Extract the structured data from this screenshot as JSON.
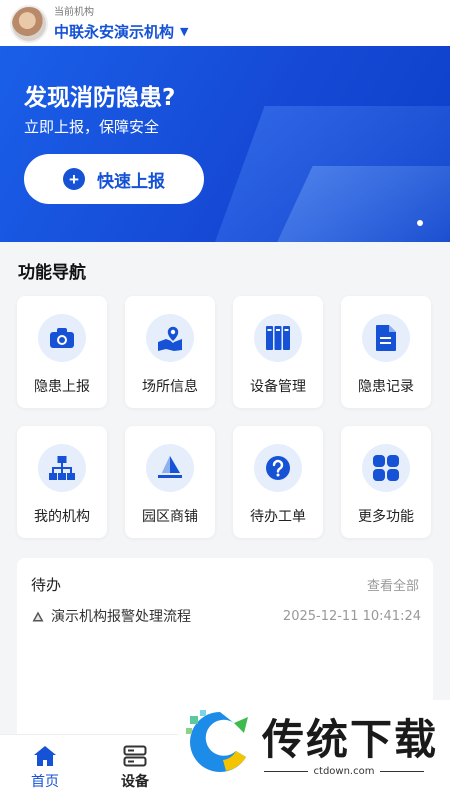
{
  "header": {
    "caption": "当前机构",
    "org_name": "中联永安演示机构",
    "caret": "▼"
  },
  "banner": {
    "title": "发现消防隐患?",
    "subtitle": "立即上报，保障安全",
    "quick_button_label": "快速上报",
    "plus": "+"
  },
  "nav_section": {
    "title": "功能导航",
    "items": [
      {
        "label": "隐患上报",
        "icon": "camera-icon"
      },
      {
        "label": "场所信息",
        "icon": "map-pin-icon"
      },
      {
        "label": "设备管理",
        "icon": "binders-icon"
      },
      {
        "label": "隐患记录",
        "icon": "document-icon"
      },
      {
        "label": "我的机构",
        "icon": "org-chart-icon"
      },
      {
        "label": "园区商铺",
        "icon": "shop-flag-icon"
      },
      {
        "label": "待办工单",
        "icon": "question-icon"
      },
      {
        "label": "更多功能",
        "icon": "grid-icon"
      }
    ]
  },
  "todo": {
    "title": "待办",
    "view_all": "查看全部",
    "items": [
      {
        "text": "演示机构报警处理流程",
        "time": "2025-12-11 10:41:24"
      }
    ]
  },
  "tabbar": {
    "items": [
      {
        "label": "首页",
        "icon": "home-icon",
        "active": true
      },
      {
        "label": "设备",
        "icon": "device-icon",
        "active": false
      }
    ]
  },
  "watermark": {
    "brand": "传统下载",
    "url": "ctdown.com"
  },
  "colors": {
    "primary": "#1552d6",
    "icon_bg": "#e6eefc",
    "page_bg": "#f4f5f7"
  }
}
